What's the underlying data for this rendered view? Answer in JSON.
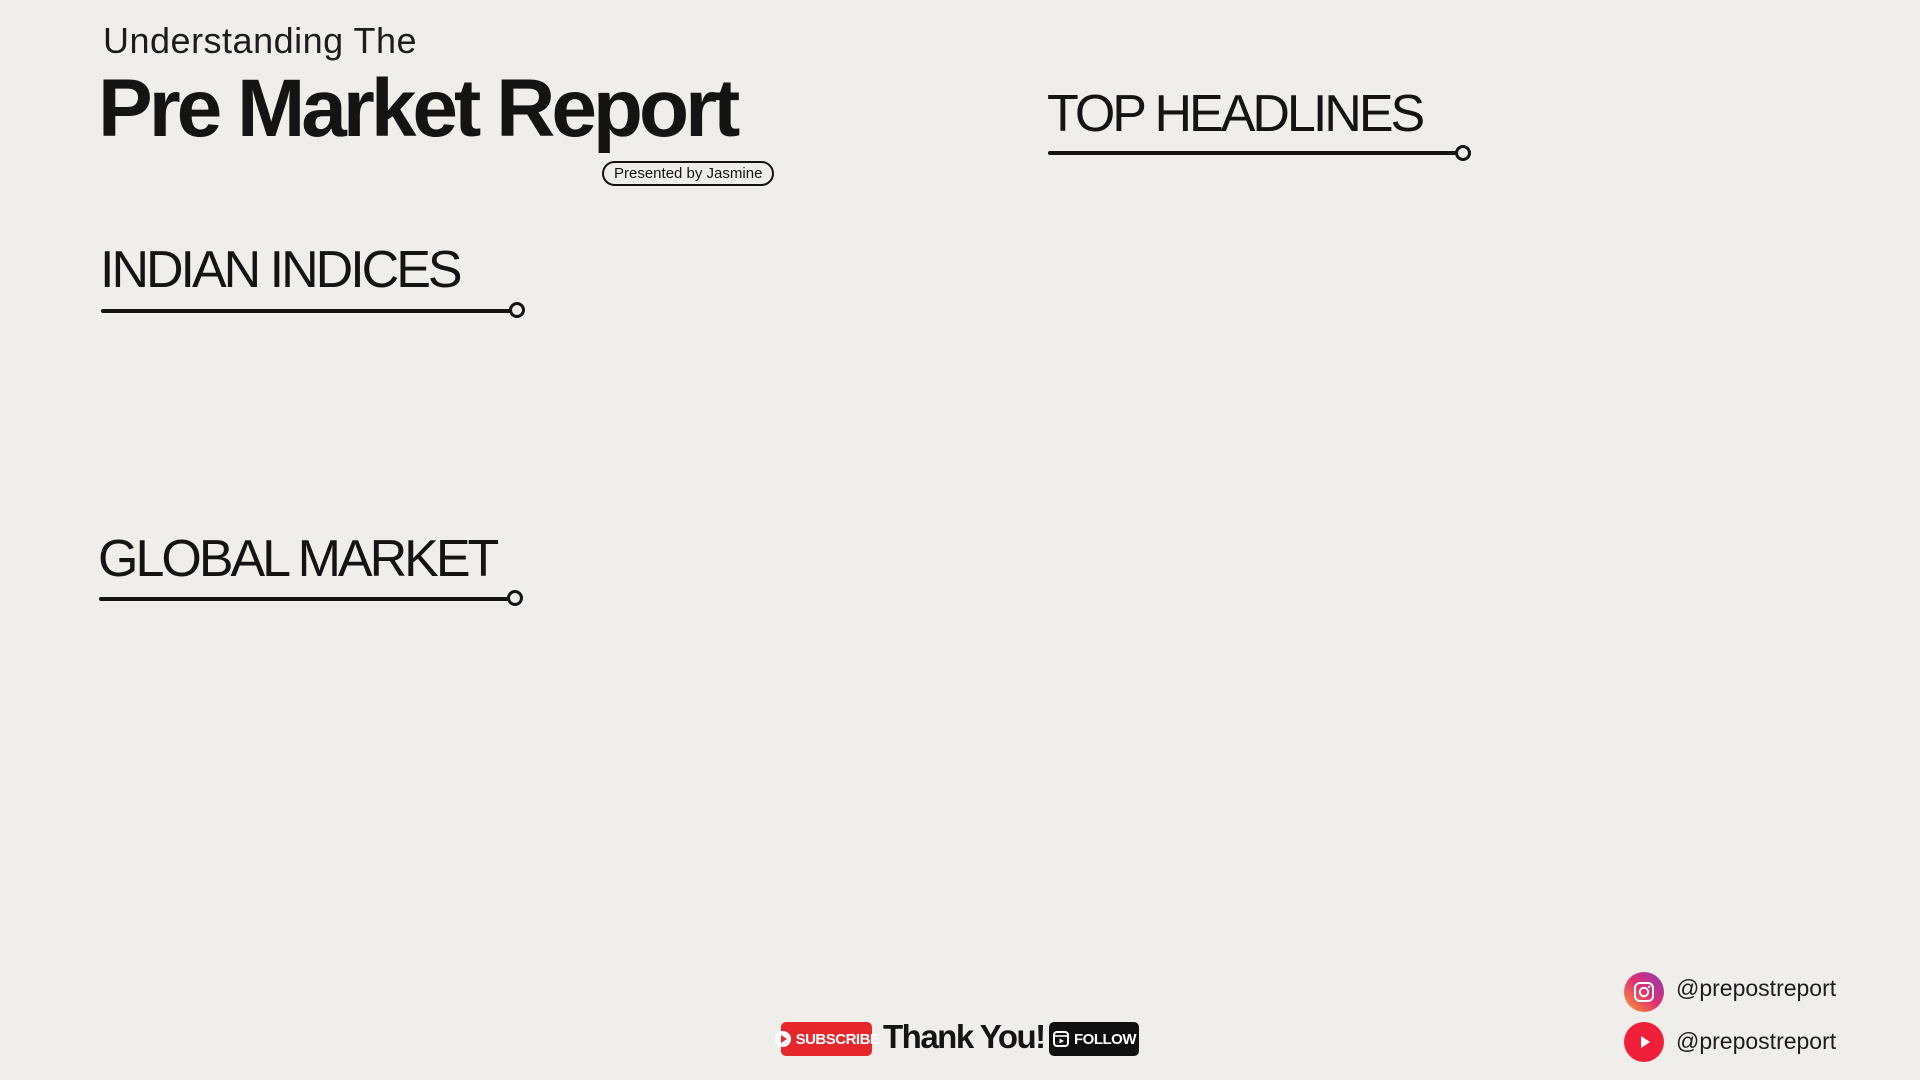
{
  "header": {
    "subtitle": "Understanding The",
    "title": "Pre Market Report",
    "presenter": "Presented by Jasmine"
  },
  "sections": {
    "headlines": "TOP HEADLINES",
    "indian_indices": "INDIAN INDICES",
    "global_market": "GLOBAL MARKET"
  },
  "footer": {
    "subscribe_label": "SUBSCRIBE",
    "thanks": "Thank You!",
    "follow_label": "FOLLOW"
  },
  "social": {
    "instagram_handle": "@prepostreport",
    "youtube_handle": "@prepostreport"
  },
  "colors": {
    "background": "#f0eeea",
    "text": "#141414",
    "subscribe_red": "#e5262b",
    "youtube_red": "#f0203a"
  }
}
